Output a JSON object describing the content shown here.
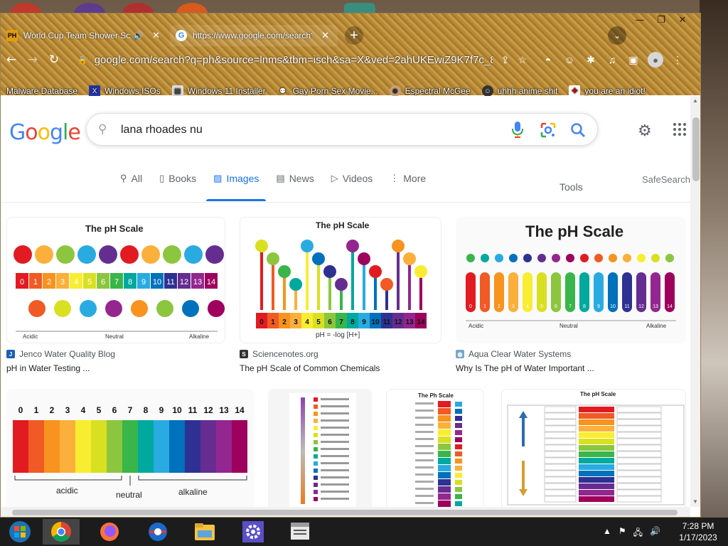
{
  "browser": {
    "tabs": [
      {
        "title": "World Cup Team Shower Sce",
        "favicon": "PH",
        "audio": true
      },
      {
        "title": "https://www.google.com/search?",
        "favicon": "G",
        "active": true
      }
    ],
    "url": "google.com/search?q=ph&source=lnms&tbm=isch&sa=X&ved=2ahUKEwiZ9K7f7c_8...",
    "window_controls": [
      "—",
      "❐",
      "✕"
    ],
    "bookmarks": [
      {
        "label": "Malware Database"
      },
      {
        "label": "Windows ISOs"
      },
      {
        "label": "Windows 11 Installer"
      },
      {
        "label": "Gay Porn Sex Movie..."
      },
      {
        "label": "Espectral McGee"
      },
      {
        "label": "uhhh anime shit"
      },
      {
        "label": "you are an idiot!"
      }
    ]
  },
  "google": {
    "logo": [
      "G",
      "o",
      "o",
      "g",
      "l",
      "e"
    ],
    "query": "lana rhoades nu",
    "tabs": [
      {
        "label": "All",
        "icon": "search-icon"
      },
      {
        "label": "Books",
        "icon": "book-icon"
      },
      {
        "label": "Images",
        "icon": "image-icon",
        "active": true
      },
      {
        "label": "News",
        "icon": "news-icon"
      },
      {
        "label": "Videos",
        "icon": "video-icon"
      },
      {
        "label": "More",
        "icon": "more-vert-icon"
      }
    ],
    "tools": "Tools",
    "safesearch": "SafeSearch",
    "results": [
      {
        "title": "The pH Scale",
        "source": "Jenco Water Quality Blog",
        "caption": "pH in Water Testing ...",
        "labels": [
          "Acidic",
          "Neutral",
          "Alkaline"
        ],
        "source_color": "#1a5fb4",
        "source_icon": "J"
      },
      {
        "title": "The pH Scale",
        "source": "Sciencenotes.org",
        "caption": "The pH Scale of Common Chemicals",
        "formula": "pH = -log [H+]",
        "source_color": "#333333",
        "source_icon": "S"
      },
      {
        "title": "The pH Scale",
        "source": "Aqua Clear Water Systems",
        "caption": "Why Is The pH of Water Important ...",
        "labels": [
          "Acidic",
          "Neutral",
          "Alkaline"
        ],
        "source_color": "#7aa7c7",
        "source_icon": "◍"
      },
      {
        "labels": [
          "acidic",
          "neutral",
          "alkaline"
        ]
      },
      {},
      {
        "title": "The Ph Scale"
      },
      {
        "title": "The pH Scale"
      }
    ],
    "scale_numbers": [
      "0",
      "1",
      "2",
      "3",
      "4",
      "5",
      "6",
      "7",
      "8",
      "9",
      "10",
      "11",
      "12",
      "13",
      "14"
    ]
  },
  "colors": {
    "ph": [
      "#e21b22",
      "#f15a24",
      "#f7931e",
      "#fbb03b",
      "#f9ed32",
      "#d9e021",
      "#8cc63f",
      "#39b54a",
      "#00a99d",
      "#29abe2",
      "#0071bc",
      "#2e3192",
      "#662d91",
      "#93278f",
      "#9e005d"
    ],
    "accent": "#1a73e8"
  },
  "taskbar": {
    "apps": [
      "start-icon",
      "chrome-icon",
      "firefox-icon",
      "edge-icon",
      "file-explorer-icon",
      "settings-icon",
      "store-icon"
    ],
    "time": "7:28 PM",
    "date": "1/17/2023"
  }
}
